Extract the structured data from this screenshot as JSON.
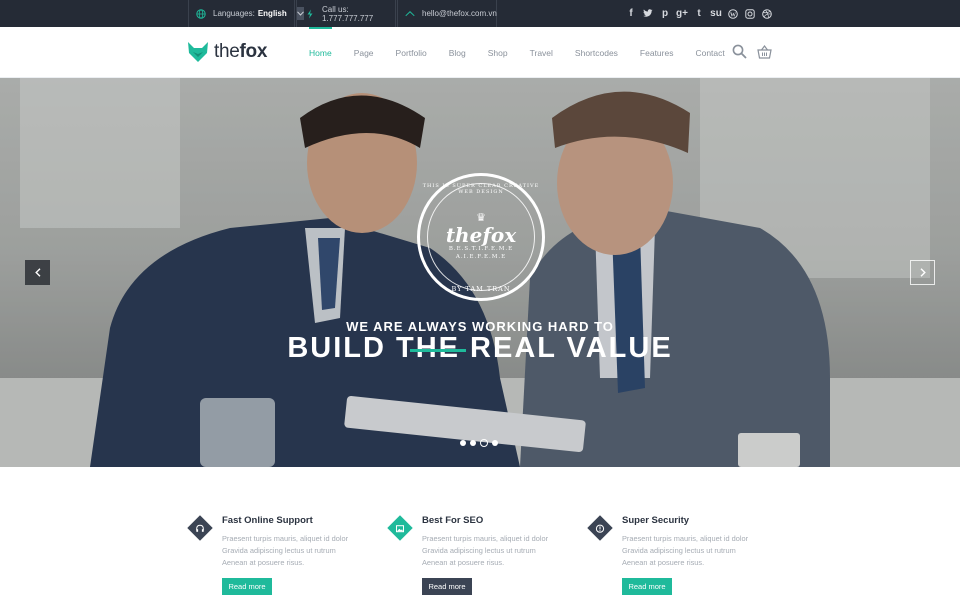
{
  "topbar": {
    "languages_label": "Languages:",
    "language_value": "English",
    "call_text": "Call us: 1.777.777.777",
    "email_text": "hello@thefox.com.vn",
    "socials": [
      "facebook-icon",
      "twitter-icon",
      "pinterest-icon",
      "google-plus-icon",
      "tumblr-icon",
      "stumbleupon-icon",
      "wordpress-icon",
      "instagram-icon",
      "dribbble-icon"
    ]
  },
  "header": {
    "logo_prefix": "the",
    "logo_bold": "fox",
    "nav": [
      {
        "label": "Home",
        "active": true
      },
      {
        "label": "Page"
      },
      {
        "label": "Portfolio"
      },
      {
        "label": "Blog"
      },
      {
        "label": "Shop"
      },
      {
        "label": "Travel"
      },
      {
        "label": "Shortcodes"
      },
      {
        "label": "Features"
      },
      {
        "label": "Contact"
      }
    ]
  },
  "hero": {
    "badge": {
      "ring_top": "THIS IS SUPER CLEAR CREATIVE WEB DESIGN",
      "brand": "thefox",
      "line1": "B.E.S.T.I.F.E.M.E",
      "line2": "A.I.E.F.E.M.E",
      "ring_bottom": "BY TAM TRAN"
    },
    "subtitle": "WE ARE ALWAYS WORKING HARD TO",
    "title_pre": "BUILD T",
    "title_hl": "HE",
    "title_post": " REAL VALUE",
    "slides_total": 4,
    "active_slide": 3
  },
  "features": [
    {
      "title": "Fast Online Support",
      "text1": "Praesent turpis mauris, aliquet id dolor",
      "text2": "Gravida adipiscing lectus ut rutrum",
      "text3": "Aenean at posuere risus.",
      "button": "Read more",
      "icon": "headset-icon"
    },
    {
      "title": "Best For SEO",
      "text1": "Praesent turpis mauris, aliquet id dolor",
      "text2": "Gravida adipiscing lectus ut rutrum",
      "text3": "Aenean at posuere risus.",
      "button": "Read more",
      "icon": "image-icon"
    },
    {
      "title": "Super Security",
      "text1": "Praesent turpis mauris, aliquet id dolor",
      "text2": "Gravida adipiscing lectus ut rutrum",
      "text3": "Aenean at posuere risus.",
      "button": "Read more",
      "icon": "shield-icon"
    }
  ],
  "colors": {
    "accent": "#1fba9b",
    "dark": "#3b4454",
    "topbar": "#252b36"
  }
}
